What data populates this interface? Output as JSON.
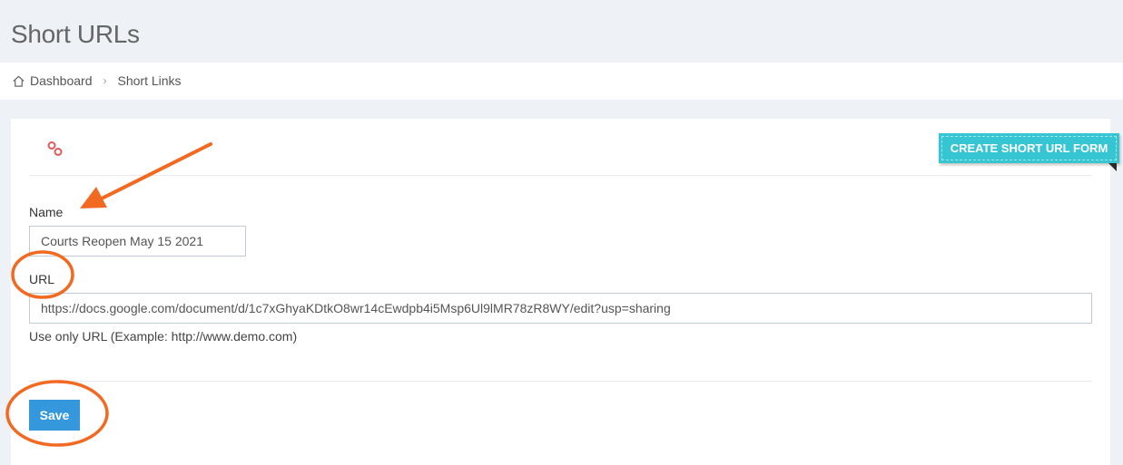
{
  "header": {
    "title": "Short URLs"
  },
  "breadcrumb": {
    "items": [
      {
        "label": "Dashboard"
      },
      {
        "label": "Short Links"
      }
    ]
  },
  "card": {
    "ribbon_label": "CREATE SHORT URL FORM"
  },
  "form": {
    "name_label": "Name",
    "name_value": "Courts Reopen May 15 2021",
    "url_label": "URL",
    "url_value": "https://docs.google.com/document/d/1c7xGhyaKDtkO8wr14cEwdpb4i5Msp6Ul9lMR78zR8WY/edit?usp=sharing",
    "url_help": "Use only URL (Example: http://www.demo.com)",
    "save_label": "Save"
  },
  "colors": {
    "ribbon": "#36c6d3",
    "save_button": "#3598dc",
    "annotation": "#f26a22",
    "link_icon": "#e05a5a"
  },
  "icons": {
    "home": "home-icon",
    "link": "link-icon",
    "separator": "chevron-right-icon"
  }
}
